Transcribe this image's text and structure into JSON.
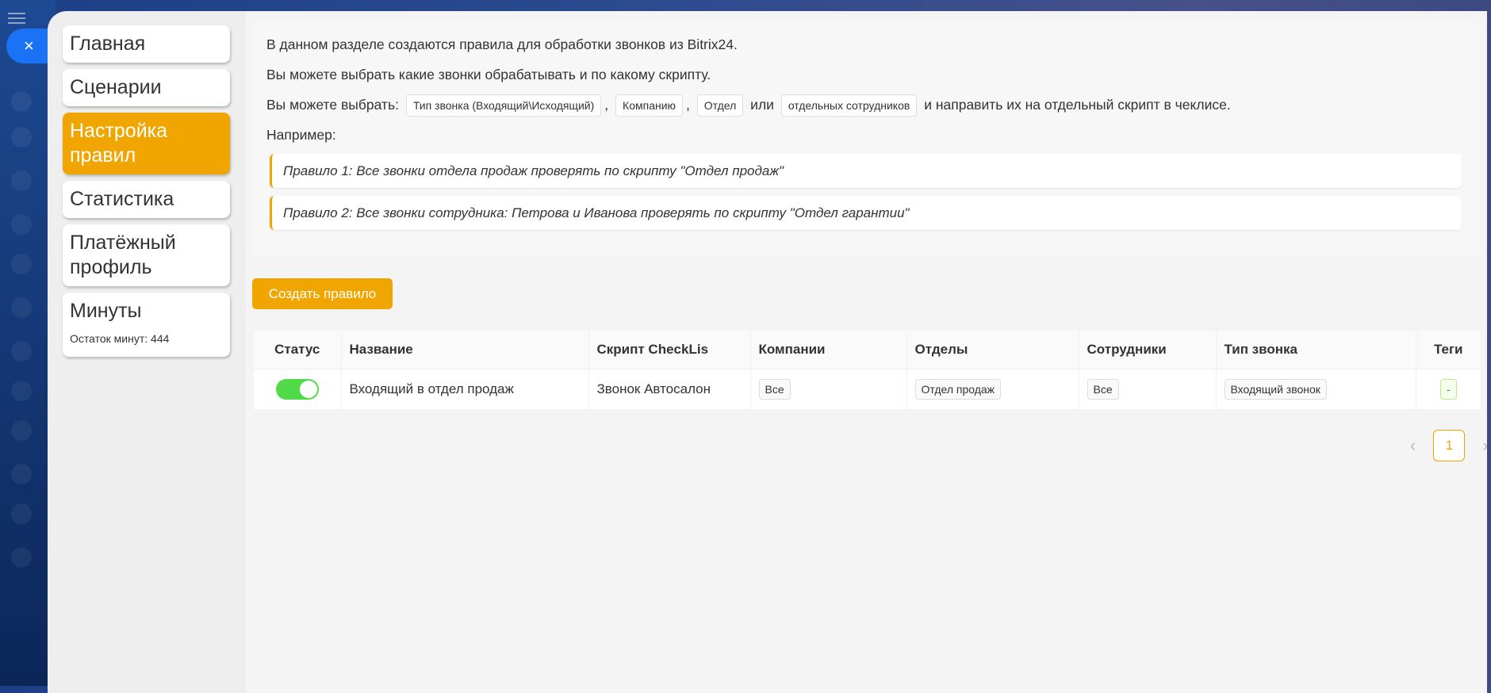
{
  "menu": {
    "items": [
      {
        "label": "Главная"
      },
      {
        "label": "Сценарии"
      },
      {
        "label": "Настройка правил"
      },
      {
        "label": "Статистика"
      },
      {
        "label": "Платёжный профиль"
      },
      {
        "label": "Минуты",
        "sub": "Остаток минут: 444"
      }
    ]
  },
  "info": {
    "line1": "В данном разделе создаются правила для обработки звонков из Bitrix24.",
    "line2": "Вы можете выбрать какие звонки обрабатывать и по какому скрипту.",
    "line3_prefix": "Вы можете выбрать:",
    "tags": [
      "Тип звонка (Входящий\\Исходящий)",
      "Компанию",
      "Отдел",
      "отдельных сотрудников"
    ],
    "comma": ",",
    "or": "или",
    "line3_suffix": "и направить их на отдельный скрипт в чеклисе.",
    "example": "Например:",
    "rules": [
      "Правило 1: Все звонки отдела продаж проверять по скрипту \"Отдел продаж\"",
      "Правило 2: Все звонки сотрудника: Петрова и Иванова проверять по скрипту \"Отдел гарантии\""
    ]
  },
  "create_button": "Создать правило",
  "table": {
    "headers": [
      "Статус",
      "Название",
      "Скрипт CheckLis",
      "Компании",
      "Отделы",
      "Сотрудники",
      "Тип звонка",
      "Теги"
    ],
    "rows": [
      {
        "status": true,
        "name": "Входящий в отдел продаж",
        "script": "Звонок Автосалон",
        "companies": "Все",
        "departments": "Отдел продаж",
        "employees": "Все",
        "call_type": "Входящий звонок",
        "tags": "-"
      }
    ]
  },
  "pagination": {
    "current": "1",
    "prev": "‹",
    "next": "›"
  },
  "close_icon": "×",
  "colors": {
    "accent": "#f0a500",
    "toggle": "#52d94a",
    "close": "#1a73f5"
  }
}
